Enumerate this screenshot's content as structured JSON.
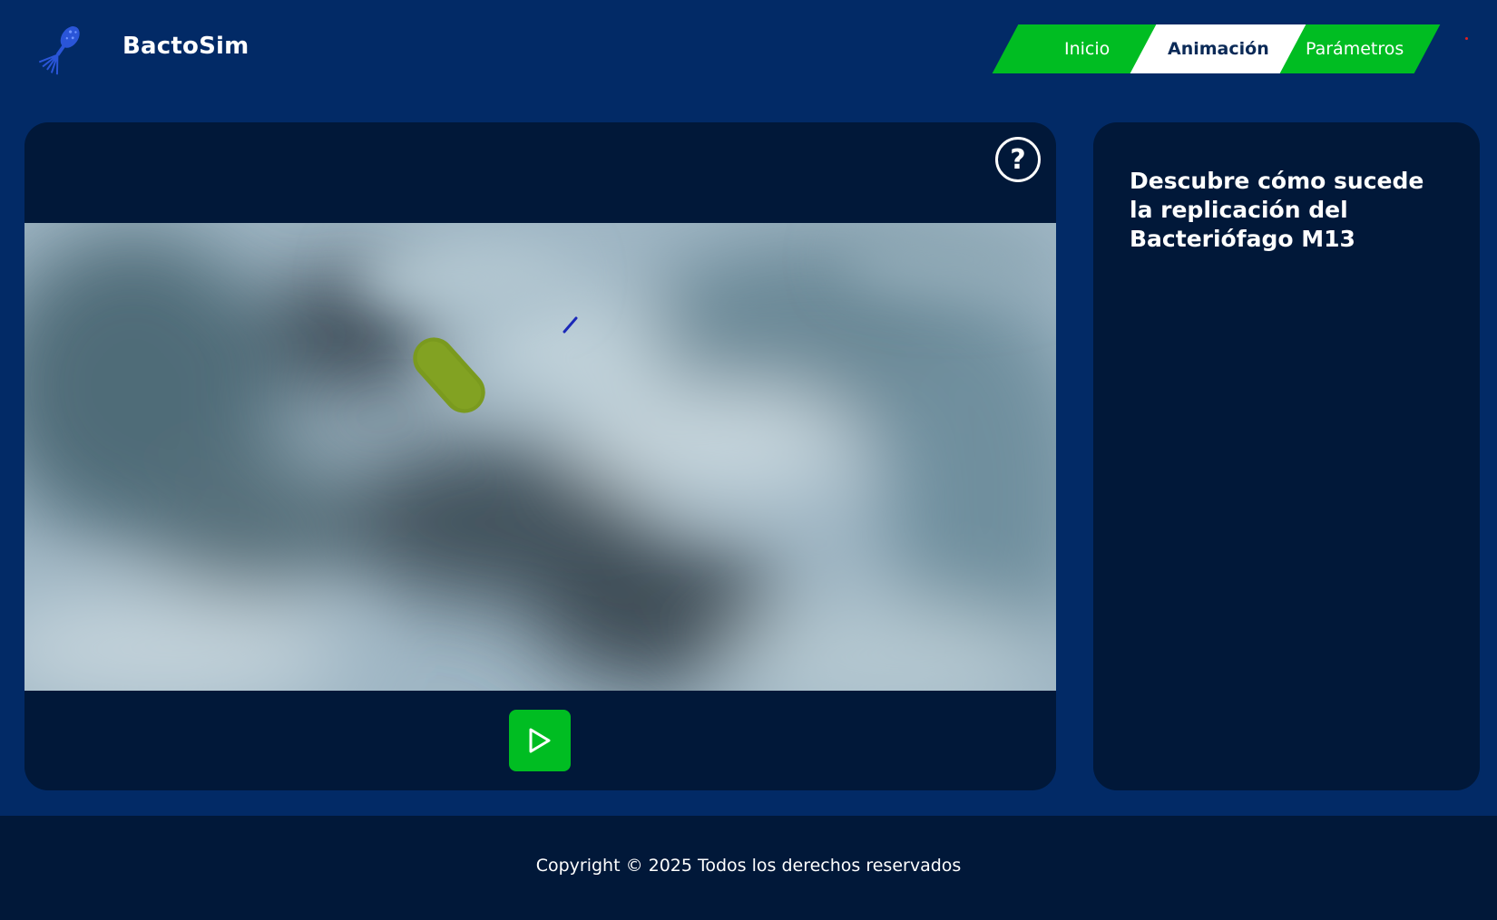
{
  "header": {
    "brand": "BactoSim",
    "logo_icon": "bacteriophage-icon"
  },
  "nav": {
    "tabs": [
      {
        "label": "Inicio",
        "active": false
      },
      {
        "label": "Animación",
        "active": true
      },
      {
        "label": "Parámetros",
        "active": false
      }
    ]
  },
  "animation": {
    "help_icon": "question-circle-icon",
    "help_label": "?",
    "play_icon": "play-icon"
  },
  "info": {
    "title": "Descubre cómo sucede la replicación del Bacteriófago M13"
  },
  "footer": {
    "copyright": "Copyright © 2025 Todos los derechos reservados"
  },
  "colors": {
    "background": "#022a66",
    "panel": "#011839",
    "accent_green": "#00bd22",
    "text_white": "#ffffff"
  }
}
